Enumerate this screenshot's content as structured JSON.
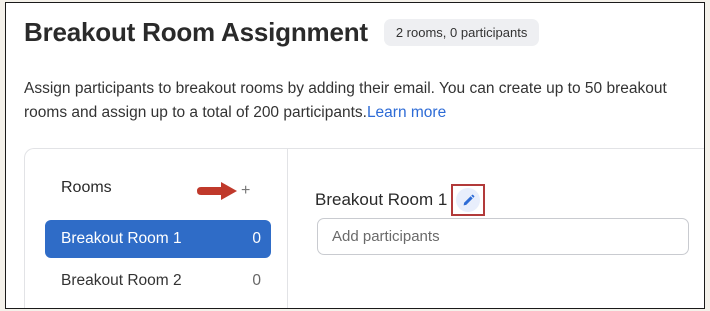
{
  "header": {
    "title": "Breakout Room Assignment",
    "badge": "2 rooms, 0 participants"
  },
  "description": {
    "text": "Assign participants to breakout rooms by adding their email. You can create up to 50 breakout rooms and assign up to a total of 200 participants.",
    "link_label": "Learn more"
  },
  "sidebar": {
    "rooms_label": "Rooms",
    "add_icon": "+",
    "rooms": [
      {
        "name": "Breakout Room 1",
        "count": "0",
        "selected": true
      },
      {
        "name": "Breakout Room 2",
        "count": "0",
        "selected": false
      }
    ]
  },
  "main": {
    "room_title": "Breakout Room 1",
    "participants_placeholder": "Add participants"
  },
  "colors": {
    "accent": "#2f6cc7",
    "link": "#2d6bd6",
    "annotation_red": "#b23a3a"
  },
  "icons": {
    "add": "plus-icon",
    "edit": "pencil-icon",
    "annotation": "arrow-icon"
  }
}
